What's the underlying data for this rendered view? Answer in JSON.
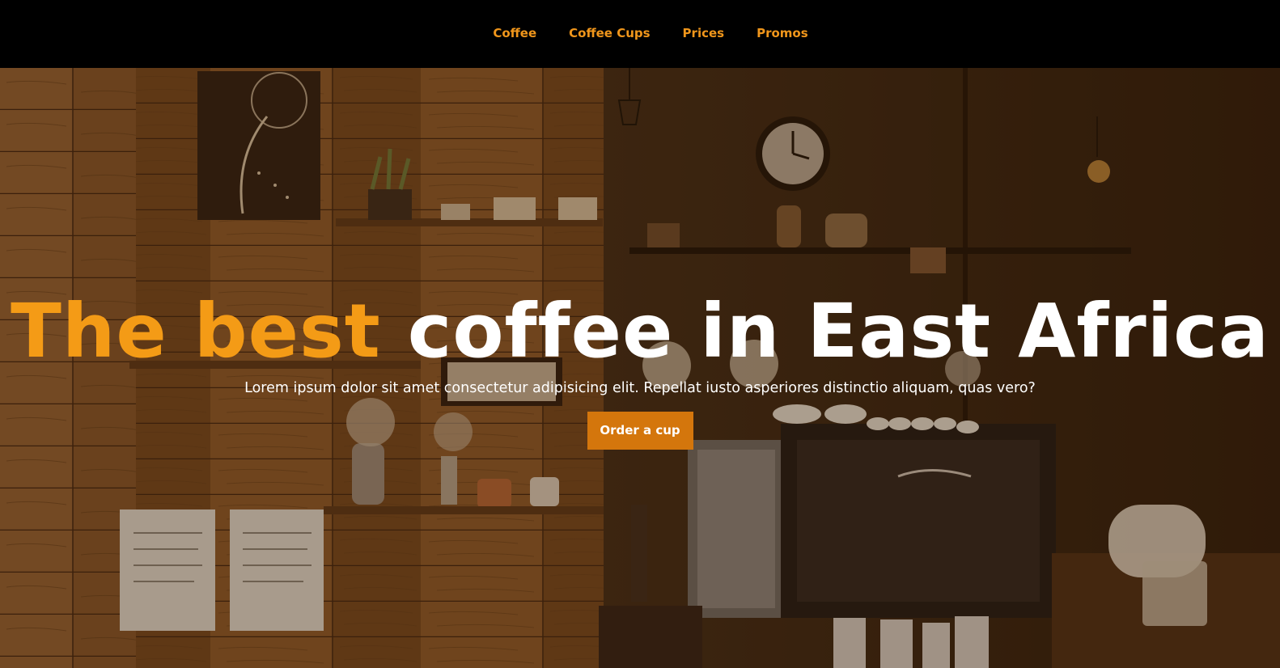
{
  "nav": {
    "items": [
      {
        "label": "Coffee"
      },
      {
        "label": "Coffee Cups"
      },
      {
        "label": "Prices"
      },
      {
        "label": "Promos"
      }
    ]
  },
  "hero": {
    "title_accent": "The best",
    "title_rest": "coffee in East Africa",
    "subtitle": "Lorem ipsum dolor sit amet consectetur adipisicing elit. Repellat iusto asperiores distinctio aliquam, quas vero?",
    "cta_label": "Order a cup"
  },
  "colors": {
    "nav_background": "#000000",
    "accent": "#f49b16",
    "button": "#d4760c",
    "text": "#ffffff"
  }
}
